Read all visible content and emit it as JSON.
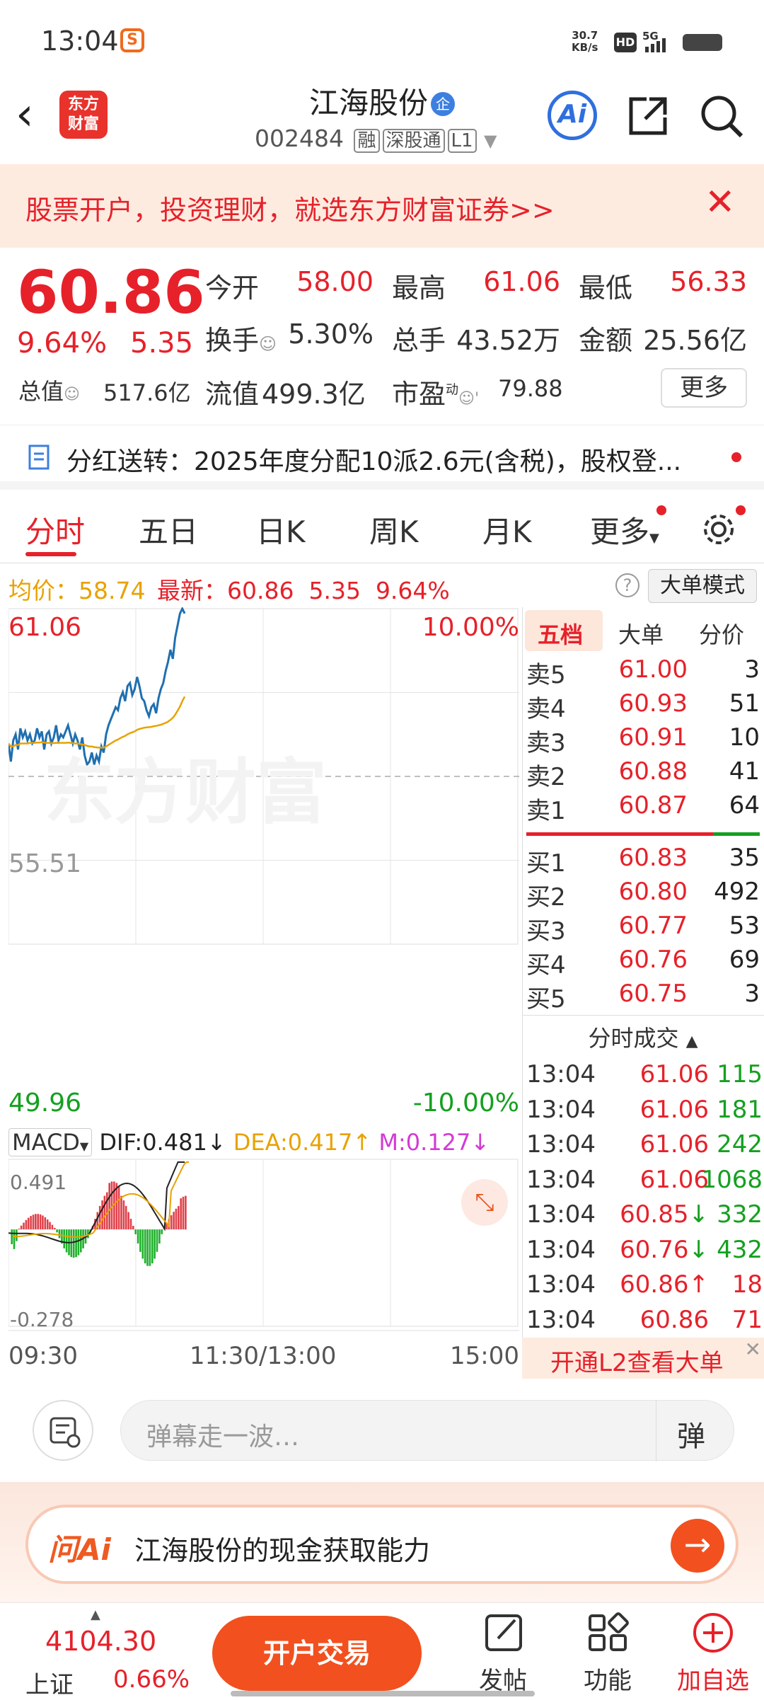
{
  "status": {
    "time": "13:04",
    "speed_value": "30.7",
    "speed_unit": "KB/s",
    "hd": "HD",
    "net": "5G"
  },
  "header": {
    "logo_line1": "东方",
    "logo_line2": "财富",
    "name": "江海股份",
    "badge": "企",
    "code": "002484",
    "tags": [
      "融",
      "深股通",
      "L1"
    ],
    "ai": "Ai"
  },
  "banner": {
    "text": "股票开户，投资理财，就选东方财富证券>>"
  },
  "quote": {
    "price": "60.86",
    "change_pct": "9.64%",
    "change": "5.35",
    "open_label": "今开",
    "open": "58.00",
    "high_label": "最高",
    "high": "61.06",
    "low_label": "最低",
    "low": "56.33",
    "turnover_label": "换手",
    "turnover": "5.30%",
    "volume_label": "总手",
    "volume": "43.52万",
    "amount_label": "金额",
    "amount": "25.56亿",
    "mktcap_label": "总值",
    "mktcap": "517.6亿",
    "float_label": "流值",
    "float": "499.3亿",
    "pe_label": "市盈",
    "pe_sup": "动",
    "pe": "79.88",
    "more": "更多"
  },
  "notice": {
    "text": "分红送转：2025年度分配10派2.6元(含税)，股权登..."
  },
  "tabs": [
    "分时",
    "五日",
    "日K",
    "周K",
    "月K",
    "更多"
  ],
  "infobar": {
    "avg_label": "均价：",
    "avg": "58.74",
    "latest_label": "最新：",
    "latest": "60.86",
    "change": "5.35",
    "change_pct": "9.64%",
    "mode": "大单模式"
  },
  "chart_data": {
    "type": "line",
    "title": "",
    "y_top": "61.06",
    "y_mid": "55.51",
    "y_bottom": "49.96",
    "pct_top": "10.00%",
    "pct_bottom": "-10.00%",
    "x_labels": [
      "09:30",
      "11:30/13:00",
      "15:00"
    ],
    "ylim": [
      49.96,
      61.06
    ],
    "series": [
      {
        "name": "",
        "color": "#1f6fb0",
        "values": [
          56.6,
          56.0,
          56.7,
          56.9,
          56.4,
          57.1,
          56.8,
          57.0,
          56.7,
          56.9,
          56.6,
          56.7,
          57.1,
          56.8,
          57.0,
          56.4,
          56.9,
          57.0,
          56.6,
          56.8,
          57.2,
          56.7,
          56.9,
          56.8,
          57.0,
          57.2,
          56.9,
          56.6,
          56.9,
          56.7,
          56.4,
          56.8,
          56.2,
          55.9,
          56.0,
          56.3,
          55.9,
          56.2,
          56.0,
          56.5,
          56.3,
          56.9,
          57.2,
          57.4,
          57.6,
          57.8,
          57.7,
          58.1,
          58.3,
          58.0,
          58.5,
          58.6,
          58.2,
          58.4,
          58.8,
          58.5,
          58.1,
          58.0,
          57.7,
          57.5,
          57.8,
          57.9,
          57.6,
          58.1,
          58.4,
          58.6,
          59.0,
          59.3,
          59.7,
          59.4,
          60.1,
          60.5,
          60.9,
          61.06,
          60.9
        ]
      },
      {
        "name": "",
        "color": "#e8a200",
        "values": [
          56.6,
          56.5,
          56.5,
          56.55,
          56.55,
          56.6,
          56.6,
          56.6,
          56.6,
          56.62,
          56.62,
          56.62,
          56.63,
          56.63,
          56.64,
          56.63,
          56.62,
          56.62,
          56.61,
          56.61,
          56.62,
          56.62,
          56.62,
          56.62,
          56.62,
          56.63,
          56.62,
          56.61,
          56.6,
          56.6,
          56.58,
          56.57,
          56.55,
          56.52,
          56.5,
          56.5,
          56.48,
          56.47,
          56.46,
          56.46,
          56.46,
          56.5,
          56.55,
          56.6,
          56.65,
          56.7,
          56.73,
          56.78,
          56.82,
          56.85,
          56.9,
          56.94,
          56.97,
          57.0,
          57.05,
          57.08,
          57.1,
          57.12,
          57.13,
          57.14,
          57.15,
          57.17,
          57.18,
          57.2,
          57.22,
          57.25,
          57.28,
          57.32,
          57.38,
          57.45,
          57.55,
          57.68,
          57.82,
          58.0,
          58.15
        ]
      }
    ],
    "macd": {
      "label": "MACD",
      "dif": "DIF:0.481",
      "dif_arrow": "↓",
      "dea": "DEA:0.417",
      "dea_arrow": "↑",
      "m": "M:0.127",
      "m_arrow": "↓",
      "top": "0.491",
      "bottom": "-0.278"
    }
  },
  "book": {
    "tabs": [
      "五档",
      "大单",
      "分价"
    ],
    "asks": [
      {
        "l": "卖5",
        "p": "61.00",
        "v": "3"
      },
      {
        "l": "卖4",
        "p": "60.93",
        "v": "51"
      },
      {
        "l": "卖3",
        "p": "60.91",
        "v": "10"
      },
      {
        "l": "卖2",
        "p": "60.88",
        "v": "41"
      },
      {
        "l": "卖1",
        "p": "60.87",
        "v": "64"
      }
    ],
    "bids": [
      {
        "l": "买1",
        "p": "60.83",
        "v": "35"
      },
      {
        "l": "买2",
        "p": "60.80",
        "v": "492"
      },
      {
        "l": "买3",
        "p": "60.77",
        "v": "53"
      },
      {
        "l": "买4",
        "p": "60.76",
        "v": "69"
      },
      {
        "l": "买5",
        "p": "60.75",
        "v": "3"
      }
    ],
    "trades_title": "分时成交",
    "trades": [
      {
        "t": "13:04",
        "p": "61.06",
        "a": "",
        "v": "115",
        "c": "green"
      },
      {
        "t": "13:04",
        "p": "61.06",
        "a": "",
        "v": "181",
        "c": "green"
      },
      {
        "t": "13:04",
        "p": "61.06",
        "a": "",
        "v": "242",
        "c": "green"
      },
      {
        "t": "13:04",
        "p": "61.06",
        "a": "",
        "v": "1068",
        "c": "green"
      },
      {
        "t": "13:04",
        "p": "60.85",
        "a": "↓",
        "v": "332",
        "c": "green"
      },
      {
        "t": "13:04",
        "p": "60.76",
        "a": "↓",
        "v": "432",
        "c": "green"
      },
      {
        "t": "13:04",
        "p": "60.86",
        "a": "↑",
        "v": "18",
        "c": "red"
      },
      {
        "t": "13:04",
        "p": "60.86",
        "a": "",
        "v": "71",
        "c": "red"
      }
    ],
    "l2": "开通L2查看大单"
  },
  "danmu": {
    "placeholder": "弹幕走一波…",
    "btn": "弹"
  },
  "aibar": {
    "logo": "问Ai",
    "text": "江海股份的现金获取能力"
  },
  "nav": {
    "index_value": "4104.30",
    "index_name": "上证",
    "index_pct": "0.66%",
    "trade": "开户交易",
    "post": "发帖",
    "func": "功能",
    "watch": "加自选"
  }
}
